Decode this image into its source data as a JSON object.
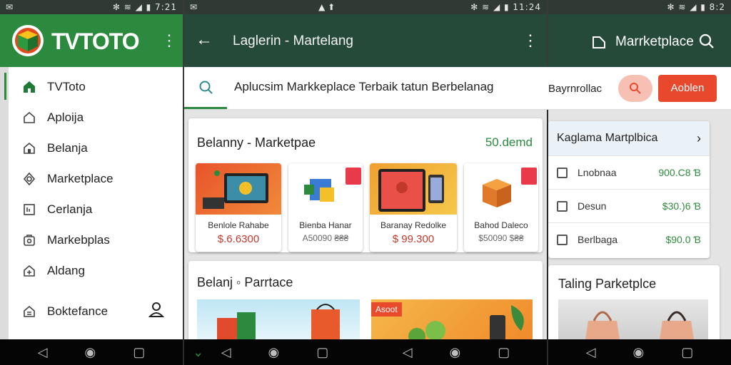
{
  "colors": {
    "appbar": "#264a3a",
    "green_brand": "#2b8a3e",
    "orange_button": "#e8482c",
    "price_red": "#c0392b",
    "price_green": "#2e8b3c"
  },
  "screen1": {
    "status_right": "✻ ≋ ◢ ▮ 7:21",
    "logo_text": "TVTOTO",
    "menu_items": [
      {
        "icon": "home-icon",
        "label": "TVToto"
      },
      {
        "icon": "house-icon",
        "label": "Aploija"
      },
      {
        "icon": "house-icon",
        "label": "Belanja"
      },
      {
        "icon": "gear-icon",
        "label": "Marketplace"
      },
      {
        "icon": "list-icon",
        "label": "Cerlanja"
      },
      {
        "icon": "cart-icon",
        "label": "Markebplas"
      },
      {
        "icon": "gift-icon",
        "label": "Aldang"
      },
      {
        "icon": "badge-icon",
        "label": "Boktefance"
      }
    ]
  },
  "screen2": {
    "status_right": "✻ ≋ ◢ ▮ 11:24",
    "title": "Laglerin - Martelang",
    "search_text": "Aplucsim Markkeplace Terbaik tatun Berbelanag",
    "section1": {
      "title": "Belanny - Marketpae",
      "link": "50.demd"
    },
    "products": [
      {
        "name": "Benlole Rahabe",
        "price": "$.6.6300"
      },
      {
        "name": "Bienba Hanar",
        "price": "A50090 ₴₴₴"
      },
      {
        "name": "Baranay Redolke",
        "price": "$ 99.300"
      },
      {
        "name": "Bahod Daleco",
        "price": "$50090 $₴₴"
      }
    ],
    "section2": {
      "title": "Belanj ◦ Parrtace",
      "badge": "Asoot"
    }
  },
  "screen3": {
    "status_right": "✻ ≋ ◢ ▮ 8:2",
    "title": "Marrketplace",
    "download_label": "Bayrnrollac",
    "apply_label": "Aoblen",
    "card_title": "Kaglama Martplbica",
    "rows": [
      {
        "label": "Lnobnaa",
        "price": "900.C8 Ɓ"
      },
      {
        "label": "Desun",
        "price": "$30.)6 Ɓ"
      },
      {
        "label": "Berlbaga",
        "price": "$90.0 Ɓ"
      }
    ],
    "trending_title": "Taling Parketplce"
  }
}
